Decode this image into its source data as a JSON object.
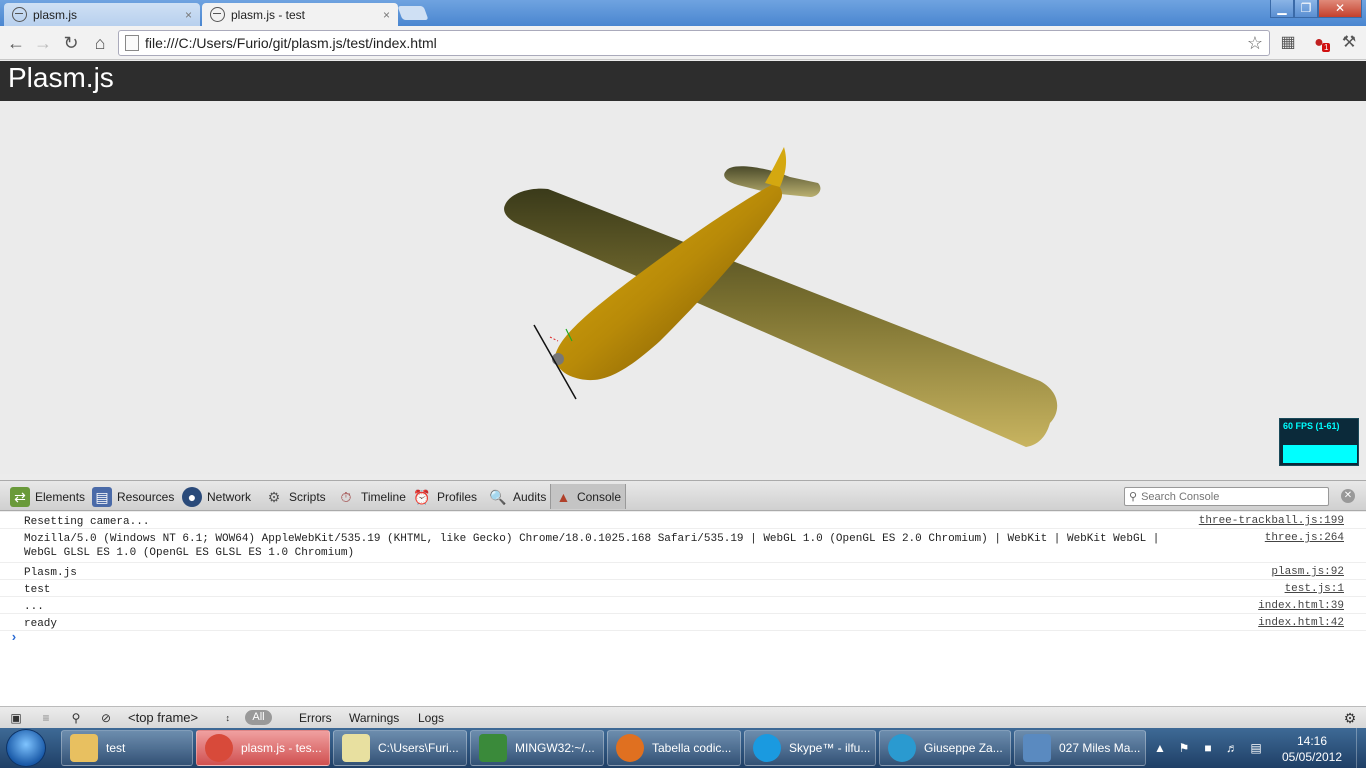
{
  "browser": {
    "tabs": [
      {
        "label": "plasm.js",
        "close": "×"
      },
      {
        "label": "plasm.js - test",
        "close": "×"
      }
    ],
    "window_controls": {
      "minimize": "▁",
      "maximize": "❐",
      "close": "✕"
    },
    "url": "file:///C:/Users/Furio/git/plasm.js/test/index.html",
    "notification_badge": "1"
  },
  "page": {
    "title": "Plasm.js",
    "fps_label": "60 FPS (1-61)"
  },
  "devtools": {
    "tabs": [
      {
        "label": "Elements",
        "icon": "elements-icon",
        "color": "#6a9a3a"
      },
      {
        "label": "Resources",
        "icon": "resources-icon",
        "color": "#4a6aa8"
      },
      {
        "label": "Network",
        "icon": "network-icon",
        "color": "#2a4a7a"
      },
      {
        "label": "Scripts",
        "icon": "scripts-icon",
        "color": "#7a7a7a"
      },
      {
        "label": "Timeline",
        "icon": "timeline-icon",
        "color": "#9a3a3a"
      },
      {
        "label": "Profiles",
        "icon": "profiles-icon",
        "color": "#8a8a8a"
      },
      {
        "label": "Audits",
        "icon": "audits-icon",
        "color": "#6a6a6a"
      },
      {
        "label": "Console",
        "icon": "console-icon",
        "color": "#b0402a"
      }
    ],
    "search_placeholder": "Search Console",
    "console": [
      {
        "msg": "Resetting camera...",
        "src": "three-trackball.js:199"
      },
      {
        "msg": "Mozilla/5.0 (Windows NT 6.1; WOW64) AppleWebKit/535.19 (KHTML, like Gecko) Chrome/18.0.1025.168 Safari/535.19 | WebGL 1.0 (OpenGL ES 2.0 Chromium) | WebKit | WebKit WebGL |\nWebGL GLSL ES 1.0 (OpenGL ES GLSL ES 1.0 Chromium)",
        "src": "three.js:264"
      },
      {
        "msg": "Plasm.js",
        "src": "plasm.js:92"
      },
      {
        "msg": "test",
        "src": "test.js:1"
      },
      {
        "msg": "...",
        "src": "index.html:39"
      },
      {
        "msg": "ready",
        "src": "index.html:42"
      }
    ],
    "prompt": "›",
    "status": {
      "frame": "<top frame>",
      "all": "All",
      "errors": "Errors",
      "warnings": "Warnings",
      "logs": "Logs"
    }
  },
  "taskbar": {
    "items": [
      {
        "label": "test",
        "icon": "folder-icon",
        "color": "#e8c060"
      },
      {
        "label": "plasm.js - tes...",
        "icon": "chrome-icon",
        "color": "#d84a3a"
      },
      {
        "label": "C:\\Users\\Furi...",
        "icon": "editor-icon",
        "color": "#e8e0a0"
      },
      {
        "label": "MINGW32:~/...",
        "icon": "git-icon",
        "color": "#3a8a3a"
      },
      {
        "label": "Tabella codic...",
        "icon": "firefox-icon",
        "color": "#e07020"
      },
      {
        "label": "Skype™ - ilfu...",
        "icon": "skype-icon",
        "color": "#1a9ae0"
      },
      {
        "label": "Giuseppe Za...",
        "icon": "chat-icon",
        "color": "#2a9ad0"
      },
      {
        "label": "027 Miles Ma...",
        "icon": "image-viewer-icon",
        "color": "#5a8ac0"
      }
    ],
    "clock_time": "14:16",
    "clock_date": "05/05/2012"
  }
}
